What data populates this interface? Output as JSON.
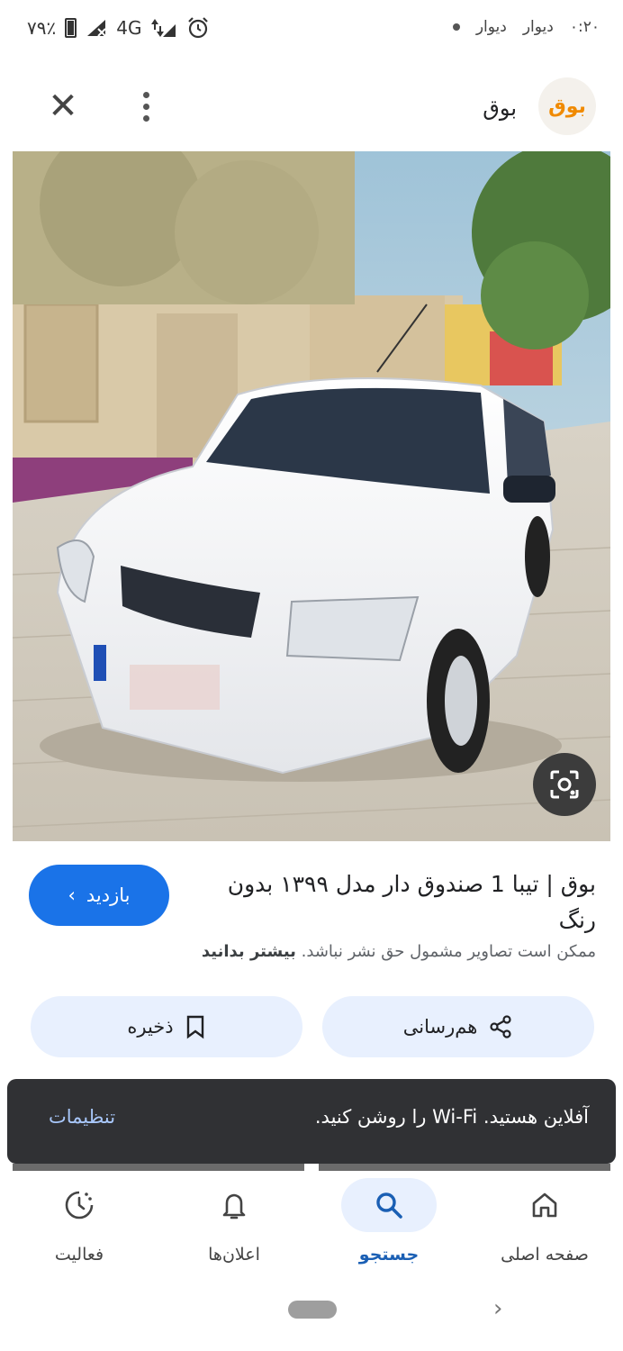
{
  "status_bar": {
    "time": "۰:۲۰",
    "notifications": [
      "دیوار",
      "دیوار"
    ],
    "network": "4G",
    "battery": "۷۹٪"
  },
  "header": {
    "site_name": "بوق",
    "logo_text": "بوق",
    "close_icon": "close-icon",
    "more_icon": "more-vert-icon"
  },
  "result": {
    "title": "بوق | تیبا 1 صندوق دار مدل ۱۳۹۹ بدون رنگ",
    "visit_label": "بازدید",
    "copyright_text": "ممکن است تصاویر مشمول حق نشر نباشد.",
    "learn_more": "بیشتر بدانید",
    "share_label": "هم‌رسانی",
    "save_label": "ذخیره"
  },
  "snackbar": {
    "message": "آفلاین هستید. Wi-Fi را روشن کنید.",
    "action": "تنظیمات"
  },
  "bottom_nav": {
    "items": [
      {
        "label": "صفحه اصلی",
        "icon": "home-icon"
      },
      {
        "label": "جستجو",
        "icon": "search-icon",
        "active": true
      },
      {
        "label": "اعلان‌ها",
        "icon": "bell-icon"
      },
      {
        "label": "فعالیت",
        "icon": "activity-icon"
      }
    ]
  },
  "colors": {
    "accent": "#1a73e8",
    "chip_bg": "#e8f0fe",
    "snackbar_bg": "#303134",
    "snackbar_action": "#a8c7fa"
  }
}
